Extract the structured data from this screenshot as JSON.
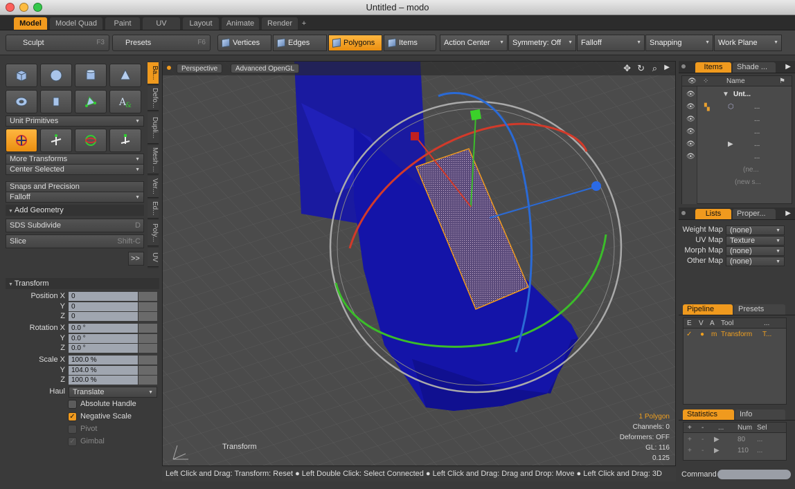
{
  "window": {
    "title": "Untitled – modo"
  },
  "tabs": [
    "Model",
    "Model Quad",
    "Paint",
    "UV",
    "Layout",
    "Animate",
    "Render",
    "+"
  ],
  "toolbar": {
    "sculpt": "Sculpt",
    "sculpt_key": "F3",
    "presets": "Presets",
    "presets_key": "F6",
    "vertices": "Vertices",
    "edges": "Edges",
    "polygons": "Polygons",
    "items": "Items",
    "action_center": "Action Center",
    "symmetry": "Symmetry: Off",
    "falloff": "Falloff",
    "snapping": "Snapping",
    "work_plane": "Work Plane"
  },
  "left": {
    "unit_primitives": "Unit Primitives",
    "more_transforms": "More Transforms",
    "center_selected": "Center Selected",
    "snaps": "Snaps and Precision",
    "falloff": "Falloff",
    "add_geometry": "Add Geometry",
    "sds": "SDS Subdivide",
    "sds_key": "D",
    "slice": "Slice",
    "slice_key": "Shift-C",
    "more": ">>",
    "side_tabs": [
      "Ba...",
      "Defo...",
      "Dupli...",
      "Mesh ...",
      "Ver...",
      "Ed...",
      "Poly...",
      "UV"
    ]
  },
  "transform": {
    "title": "Transform",
    "position_label": "Position X",
    "rotation_label": "Rotation X",
    "scale_label": "Scale X",
    "y": "Y",
    "z": "Z",
    "position": [
      "0",
      "0",
      "0"
    ],
    "rotation": [
      "0.0 °",
      "0.0 °",
      "0.0 °"
    ],
    "scale": [
      "100.0 %",
      "104.0 %",
      "100.0 %"
    ],
    "haul_label": "Haul",
    "haul": "Translate",
    "absolute_handle": "Absolute Handle",
    "negative_scale": "Negative Scale",
    "pivot": "Pivot",
    "gimbal": "Gimbal"
  },
  "viewport": {
    "perspective": "Perspective",
    "opengl": "Advanced OpenGL",
    "tool": "Transform",
    "info": {
      "polygon": "1 Polygon",
      "channels": "Channels: 0",
      "deformers": "Deformers: OFF",
      "gl": "GL: 116",
      "scale": "0.125"
    }
  },
  "status": "Left Click and Drag: Transform: Reset ● Left Double Click: Select Connected ● Left Click and Drag: Drag and Drop: Move ● Left Click and Drag: 3D",
  "right": {
    "items_tab": "Items",
    "shade_tab": "Shade ...",
    "name_col": "Name",
    "items": [
      "Unt...",
      "...",
      "...",
      "...",
      "...",
      "...",
      "(ne...",
      "(new s..."
    ],
    "lists_tab": "Lists",
    "props_tab": "Proper...",
    "maps": [
      {
        "label": "Weight Map",
        "value": "(none)"
      },
      {
        "label": "UV Map",
        "value": "Texture"
      },
      {
        "label": "Morph Map",
        "value": "(none)"
      },
      {
        "label": "Other Map",
        "value": "(none)"
      }
    ],
    "pipeline_tab": "Pipeline",
    "presets_tab": "Presets",
    "pipe_cols": [
      "E",
      "V",
      "A",
      "Tool",
      "..."
    ],
    "pipe_row": {
      "m": "m",
      "tool": "Transform",
      "t": "T..."
    },
    "stats_tab": "Statistics",
    "info_tab": "Info",
    "stats_cols": [
      "+",
      "-",
      "...",
      "Num",
      "Sel"
    ],
    "stats": [
      {
        "num": "80",
        "sel": "..."
      },
      {
        "num": "110",
        "sel": "..."
      }
    ],
    "command": "Command"
  },
  "colors": {
    "accent": "#f09a1e"
  }
}
